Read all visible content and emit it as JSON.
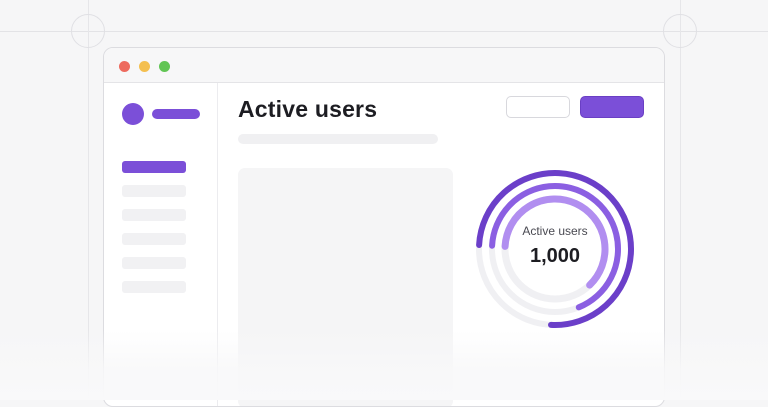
{
  "main": {
    "title": "Active users"
  },
  "chart": {
    "label": "Active users",
    "value": "1,000",
    "rings": [
      {
        "fill": 0.75,
        "color": "#6b3fc9"
      },
      {
        "fill": 0.68,
        "color": "#8b5fe2"
      },
      {
        "fill": 0.62,
        "color": "#b18ef0"
      }
    ]
  },
  "colors": {
    "accent": "#7b4fd8",
    "accent_dark": "#6b3fc9",
    "accent_light": "#b18ef0",
    "track": "#f0f0f3",
    "traffic_red": "#ed6a5e",
    "traffic_yellow": "#f4bf4f",
    "traffic_green": "#61c554"
  },
  "icons": {
    "logo": "circle-logo-icon"
  }
}
